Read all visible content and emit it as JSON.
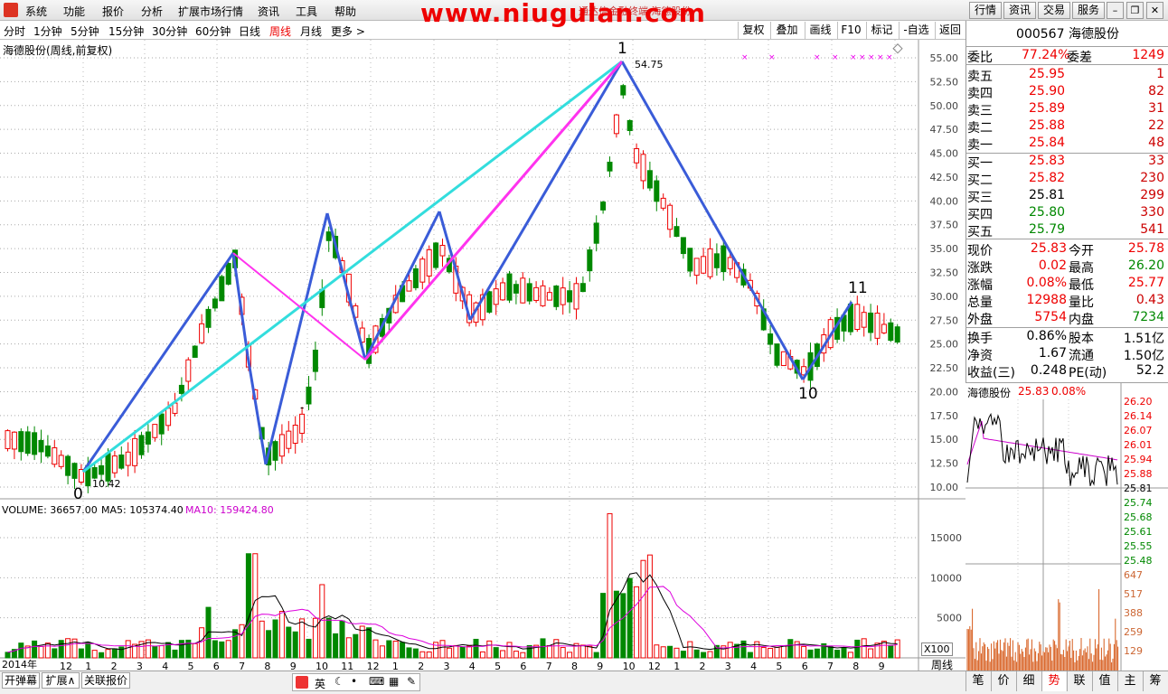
{
  "menubar": {
    "items": [
      "系统",
      "功能",
      "报价",
      "分析",
      "扩展市场行情",
      "资讯",
      "工具",
      "帮助"
    ],
    "watermark": "www.niugulan.com",
    "wm_sub": "通达信金融终端 海德股份",
    "right_buttons": [
      "行情",
      "资讯",
      "交易",
      "服务"
    ]
  },
  "periods": [
    "分时",
    "1分钟",
    "5分钟",
    "15分钟",
    "30分钟",
    "60分钟",
    "日线",
    "周线",
    "月线",
    "更多 >"
  ],
  "active_period": "周线",
  "tools": [
    "复权",
    "叠加",
    "画线",
    "F10",
    "标记",
    "-自选",
    "返回"
  ],
  "chart": {
    "title": "海德股份(周线,前复权)",
    "high_label": "54.75",
    "low_label": "10.42",
    "wave_labels": [
      "0",
      "1",
      "10",
      "11"
    ],
    "dash": "-",
    "volume_label": "VOLUME: 36657.00",
    "ma5_label": "MA5: 105374.40",
    "ma10_label": "MA10: 159424.80",
    "x100": "X100",
    "period_tag": "周线",
    "year_label": "2014年",
    "month_ticks": [
      "12",
      "1",
      "2",
      "3",
      "4",
      "5",
      "6",
      "7",
      "8",
      "9",
      "10",
      "11",
      "12",
      "1",
      "2",
      "3",
      "4",
      "5",
      "6",
      "7",
      "8",
      "9",
      "10",
      "12",
      "1",
      "2",
      "3",
      "4",
      "5",
      "6",
      "7",
      "8",
      "9"
    ]
  },
  "chart_data": {
    "type": "candlestick",
    "price_axis": [
      "55.00",
      "52.50",
      "50.00",
      "47.50",
      "45.00",
      "42.50",
      "40.00",
      "37.50",
      "35.00",
      "32.50",
      "30.00",
      "27.50",
      "25.00",
      "22.50",
      "20.00",
      "17.50",
      "15.00",
      "12.50",
      "10.00"
    ],
    "volume_axis": [
      "15000",
      "10000",
      "5000"
    ],
    "ylim": [
      10,
      55
    ],
    "marks": {
      "high": 54.75,
      "low": 10.42
    }
  },
  "quote": {
    "code": "000567",
    "name": "海德股份",
    "weibi_label": "委比",
    "weibi": "77.24%",
    "weicha_label": "委差",
    "weicha": "1249",
    "asks": [
      {
        "label": "卖五",
        "price": "25.95",
        "vol": "1"
      },
      {
        "label": "卖四",
        "price": "25.90",
        "vol": "82"
      },
      {
        "label": "卖三",
        "price": "25.89",
        "vol": "31"
      },
      {
        "label": "卖二",
        "price": "25.88",
        "vol": "22"
      },
      {
        "label": "卖一",
        "price": "25.84",
        "vol": "48"
      }
    ],
    "bids": [
      {
        "label": "买一",
        "price": "25.83",
        "vol": "33"
      },
      {
        "label": "买二",
        "price": "25.82",
        "vol": "230"
      },
      {
        "label": "买三",
        "price": "25.81",
        "vol": "299"
      },
      {
        "label": "买四",
        "price": "25.80",
        "vol": "330"
      },
      {
        "label": "买五",
        "price": "25.79",
        "vol": "541"
      }
    ],
    "stats": [
      {
        "l1": "现价",
        "v1": "25.83",
        "l2": "今开",
        "v2": "25.78"
      },
      {
        "l1": "涨跌",
        "v1": "0.02",
        "l2": "最高",
        "v2": "26.20"
      },
      {
        "l1": "涨幅",
        "v1": "0.08%",
        "l2": "最低",
        "v2": "25.77"
      },
      {
        "l1": "总量",
        "v1": "12988",
        "l2": "量比",
        "v2": "0.43"
      },
      {
        "l1": "外盘",
        "v1": "5754",
        "l2": "内盘",
        "v2": "7234"
      }
    ],
    "stats2": [
      {
        "l1": "换手",
        "v1": "0.86%",
        "l2": "股本",
        "v2": "1.51亿"
      },
      {
        "l1": "净资",
        "v1": "1.67",
        "l2": "流通",
        "v2": "1.50亿"
      },
      {
        "l1": "收益(三)",
        "v1": "0.248",
        "l2": "PE(动)",
        "v2": "52.2"
      }
    ],
    "mini_title": "海德股份",
    "mini_price": "25.83",
    "mini_pct": "0.08%",
    "mini_axis": [
      "26.20",
      "26.14",
      "26.07",
      "26.01",
      "25.94",
      "25.88",
      "25.81",
      "25.74",
      "25.68",
      "25.61",
      "25.55",
      "25.48"
    ],
    "mini_vol_axis": [
      "647",
      "517",
      "388",
      "259",
      "129"
    ]
  },
  "bottom_tabs": [
    "开弹幕",
    "扩展∧",
    "关联报价"
  ],
  "ime": [
    "英"
  ],
  "right_tabs": [
    "笔",
    "价",
    "细",
    "势",
    "联",
    "值",
    "主",
    "筹"
  ],
  "active_right_tab": "势"
}
